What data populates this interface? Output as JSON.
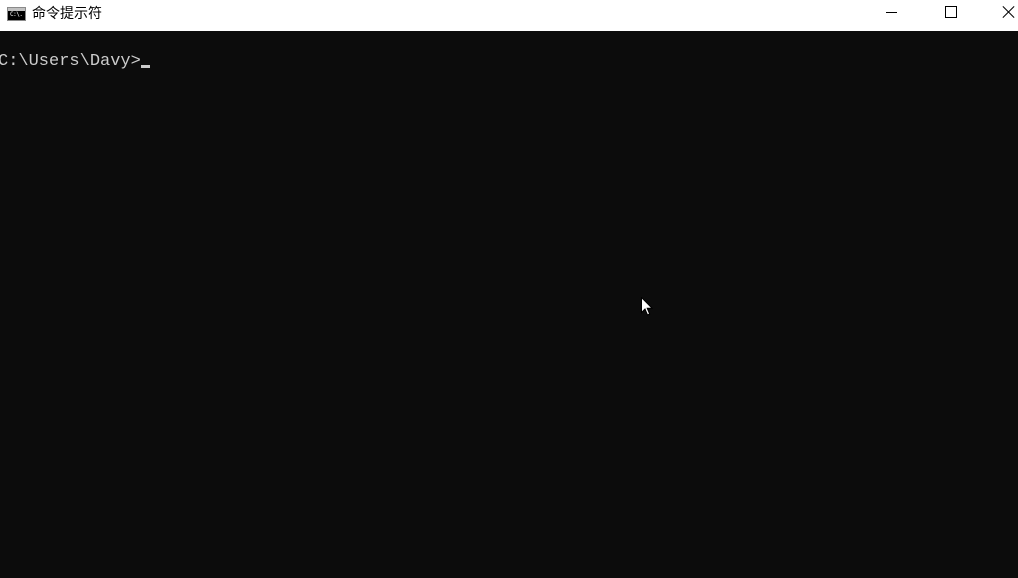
{
  "window": {
    "title": "命令提示符",
    "icon_label": "C:\\.",
    "icon": "cmd-icon",
    "controls": {
      "minimize": "minimize-icon",
      "maximize": "maximize-icon",
      "close": "close-icon"
    }
  },
  "console": {
    "prompt": "C:\\Users\\Davy>",
    "background_color": "#0c0c0c",
    "text_color": "#cccccc"
  },
  "pointer": {
    "icon": "mouse-pointer-icon"
  }
}
